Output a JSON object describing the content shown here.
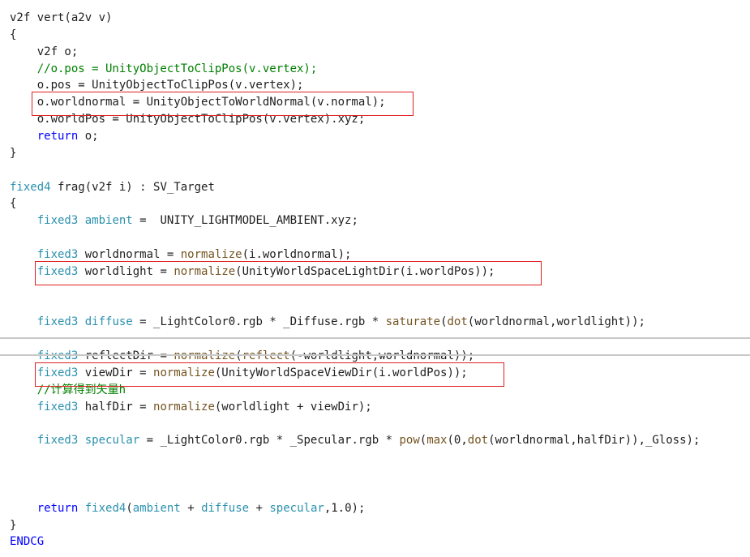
{
  "colors": {
    "background": "#ffffff",
    "text": "#1e1e1e",
    "keyword": "#0000ff",
    "type": "#2b91af",
    "function": "#74531f",
    "comment": "#008000",
    "highlight_border": "#e02020",
    "divider": "#c8c8c8"
  },
  "code": {
    "lines": [
      {
        "tokens": [
          [
            "t",
            "v2f vert(a2v v)"
          ]
        ]
      },
      {
        "tokens": [
          [
            "t",
            "{"
          ]
        ]
      },
      {
        "tokens": [
          [
            "t",
            "    v2f o;"
          ]
        ]
      },
      {
        "tokens": [
          [
            "c",
            "    //o.pos = UnityObjectToClipPos(v.vertex);"
          ]
        ]
      },
      {
        "tokens": [
          [
            "t",
            "    o.pos = UnityObjectToClipPos(v.vertex);"
          ]
        ]
      },
      {
        "tokens": [
          [
            "t",
            "    o.worldnormal = UnityObjectToWorldNormal(v.normal);"
          ]
        ]
      },
      {
        "tokens": [
          [
            "t",
            "    o.worldPos = UnityObjectToClipPos(v.vertex).xyz;"
          ]
        ]
      },
      {
        "tokens": [
          [
            "k",
            "    return"
          ],
          [
            "t",
            " o;"
          ]
        ]
      },
      {
        "tokens": [
          [
            "t",
            "}"
          ]
        ]
      },
      {
        "tokens": [
          [
            "t",
            ""
          ]
        ]
      },
      {
        "tokens": [
          [
            "y",
            "fixed4"
          ],
          [
            "t",
            " frag(v2f i) : SV_Target"
          ]
        ]
      },
      {
        "tokens": [
          [
            "t",
            "{"
          ]
        ]
      },
      {
        "tokens": [
          [
            "y",
            "    fixed3"
          ],
          [
            "t",
            " "
          ],
          [
            "y",
            "ambient"
          ],
          [
            "t",
            " =  UNITY_LIGHTMODEL_AMBIENT.xyz;"
          ]
        ]
      },
      {
        "tokens": [
          [
            "t",
            ""
          ]
        ]
      },
      {
        "tokens": [
          [
            "y",
            "    fixed3"
          ],
          [
            "t",
            " worldnormal = "
          ],
          [
            "f",
            "normalize"
          ],
          [
            "t",
            "(i.worldnormal);"
          ]
        ]
      },
      {
        "tokens": [
          [
            "y",
            "    fixed3"
          ],
          [
            "t",
            " worldlight = "
          ],
          [
            "f",
            "normalize"
          ],
          [
            "t",
            "(UnityWorldSpaceLightDir(i.worldPos));"
          ]
        ]
      },
      {
        "tokens": [
          [
            "t",
            ""
          ]
        ]
      },
      {
        "tokens": [
          [
            "t",
            ""
          ]
        ]
      },
      {
        "tokens": [
          [
            "y",
            "    fixed3"
          ],
          [
            "t",
            " "
          ],
          [
            "y",
            "diffuse"
          ],
          [
            "t",
            " = _LightColor0.rgb * _Diffuse.rgb * "
          ],
          [
            "f",
            "saturate"
          ],
          [
            "t",
            "("
          ],
          [
            "f",
            "dot"
          ],
          [
            "t",
            "(worldnormal,worldlight));"
          ]
        ]
      },
      {
        "tokens": [
          [
            "t",
            ""
          ]
        ]
      },
      {
        "tokens": [
          [
            "y",
            "    fixed3"
          ],
          [
            "t",
            " reflectDir = "
          ],
          [
            "f",
            "normalize"
          ],
          [
            "t",
            "("
          ],
          [
            "f",
            "reflect"
          ],
          [
            "t",
            "(-worldlight,worldnormal));"
          ]
        ]
      },
      {
        "tokens": [
          [
            "y",
            "    fixed3"
          ],
          [
            "t",
            " viewDir = "
          ],
          [
            "f",
            "normalize"
          ],
          [
            "t",
            "(UnityWorldSpaceViewDir(i.worldPos));"
          ]
        ]
      },
      {
        "tokens": [
          [
            "c",
            "    //计算得到矢量h"
          ]
        ]
      },
      {
        "tokens": [
          [
            "y",
            "    fixed3"
          ],
          [
            "t",
            " halfDir = "
          ],
          [
            "f",
            "normalize"
          ],
          [
            "t",
            "(worldlight + viewDir);"
          ]
        ]
      },
      {
        "tokens": [
          [
            "t",
            ""
          ]
        ]
      },
      {
        "tokens": [
          [
            "y",
            "    fixed3"
          ],
          [
            "t",
            " "
          ],
          [
            "y",
            "specular"
          ],
          [
            "t",
            " = _LightColor0.rgb * _Specular.rgb * "
          ],
          [
            "f",
            "pow"
          ],
          [
            "t",
            "("
          ],
          [
            "f",
            "max"
          ],
          [
            "t",
            "(0,"
          ],
          [
            "f",
            "dot"
          ],
          [
            "t",
            "(worldnormal,halfDir)),_Gloss);"
          ]
        ]
      },
      {
        "tokens": [
          [
            "t",
            ""
          ]
        ]
      },
      {
        "tokens": [
          [
            "t",
            ""
          ]
        ]
      },
      {
        "tokens": [
          [
            "t",
            ""
          ]
        ]
      },
      {
        "tokens": [
          [
            "k",
            "    return"
          ],
          [
            "t",
            " "
          ],
          [
            "y",
            "fixed4"
          ],
          [
            "t",
            "("
          ],
          [
            "y",
            "ambient"
          ],
          [
            "t",
            " + "
          ],
          [
            "y",
            "diffuse"
          ],
          [
            "t",
            " + "
          ],
          [
            "y",
            "specular"
          ],
          [
            "t",
            ",1.0);"
          ]
        ]
      },
      {
        "tokens": [
          [
            "t",
            "}"
          ]
        ]
      },
      {
        "tokens": [
          [
            "k",
            "ENDCG"
          ]
        ]
      }
    ],
    "highlighted_lines": [
      5,
      15,
      21
    ],
    "divider_after_lines": [
      19,
      20
    ]
  }
}
